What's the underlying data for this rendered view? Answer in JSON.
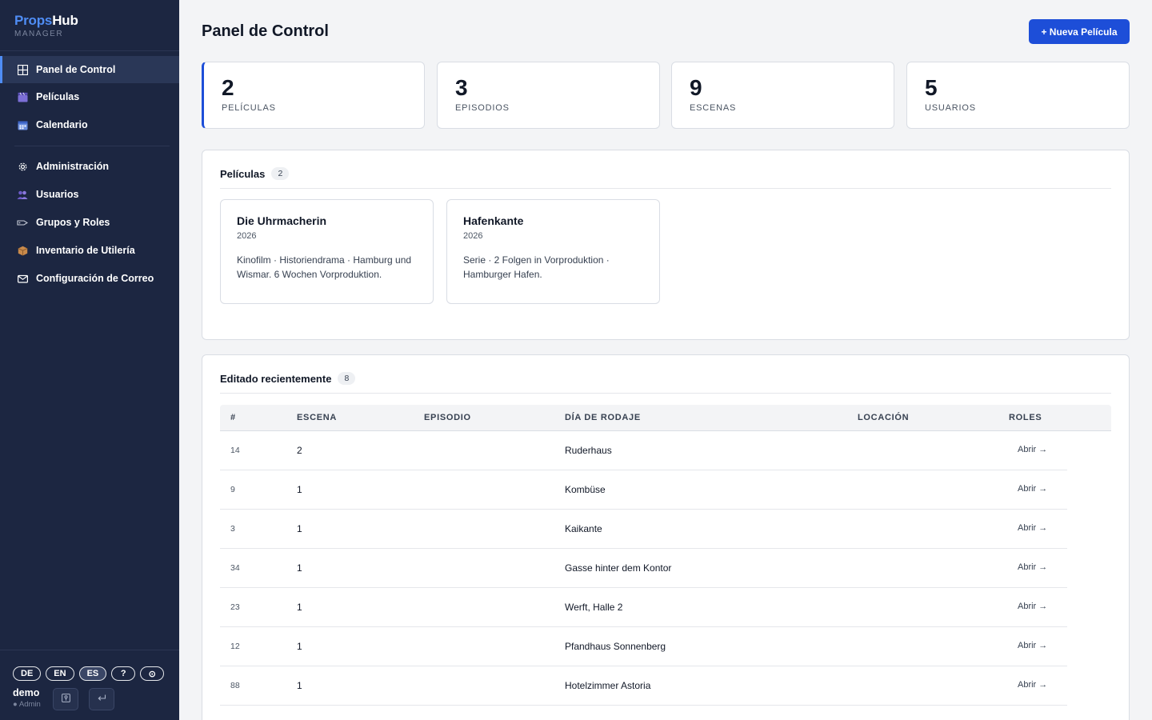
{
  "brand": {
    "name_a": "Props",
    "name_b": "Hub",
    "subtitle": "MANAGER"
  },
  "sidebar": {
    "items": [
      {
        "label": "Panel de Control",
        "icon": "grid-icon"
      },
      {
        "label": "Películas",
        "icon": "clapperboard-icon"
      },
      {
        "label": "Calendario",
        "icon": "calendar-icon"
      },
      {
        "label": "Administración",
        "icon": "gear-icon"
      },
      {
        "label": "Usuarios",
        "icon": "users-icon"
      },
      {
        "label": "Grupos y Roles",
        "icon": "tag-icon"
      },
      {
        "label": "Inventario de Utilería",
        "icon": "box-icon"
      },
      {
        "label": "Configuración de Correo",
        "icon": "mail-icon"
      }
    ],
    "languages": [
      "DE",
      "EN",
      "ES"
    ],
    "selected_language": "ES",
    "help_label": "?",
    "theme_label": "⊙",
    "user": {
      "name": "demo",
      "role": "● Admin"
    }
  },
  "header": {
    "title": "Panel de Control",
    "new_button": "+ Nueva Película"
  },
  "stats": [
    {
      "value": "2",
      "label": "PELÍCULAS"
    },
    {
      "value": "3",
      "label": "EPISODIOS"
    },
    {
      "value": "9",
      "label": "ESCENAS"
    },
    {
      "value": "5",
      "label": "USUARIOS"
    }
  ],
  "films_panel": {
    "title": "Películas",
    "count": "2",
    "films": [
      {
        "title": "Die Uhrmacherin",
        "year": "2026",
        "description": "Kinofilm · Historiendrama · Hamburg und Wismar. 6 Wochen Vorproduktion."
      },
      {
        "title": "Hafenkante",
        "year": "2026",
        "description": "Serie · 2 Folgen in Vorproduktion · Hamburger Hafen."
      }
    ]
  },
  "recent_panel": {
    "title": "Editado recientemente",
    "count": "8",
    "columns": [
      "#",
      "ESCENA",
      "EPISODIO",
      "DÍA DE RODAJE",
      "LOCACIÓN",
      "ROLES"
    ],
    "rows": [
      {
        "num": "14",
        "scene": "2",
        "episode": "",
        "location_name": "Ruderhaus",
        "action": "Abrir →"
      },
      {
        "num": "9",
        "scene": "1",
        "episode": "",
        "location_name": "Kombüse",
        "action": "Abrir →"
      },
      {
        "num": "3",
        "scene": "1",
        "episode": "",
        "location_name": "Kaikante",
        "action": "Abrir →"
      },
      {
        "num": "34",
        "scene": "1",
        "episode": "",
        "location_name": "Gasse hinter dem Kontor",
        "action": "Abrir →"
      },
      {
        "num": "23",
        "scene": "1",
        "episode": "",
        "location_name": "Werft, Halle 2",
        "action": "Abrir →"
      },
      {
        "num": "12",
        "scene": "1",
        "episode": "",
        "location_name": "Pfandhaus Sonnenberg",
        "action": "Abrir →"
      },
      {
        "num": "88",
        "scene": "1",
        "episode": "",
        "location_name": "Hotelzimmer Astoria",
        "action": "Abrir →"
      }
    ]
  },
  "colors": {
    "sidebar_bg": "#1c2641",
    "accent": "#1d4ed8",
    "brand_blue": "#4f8df5"
  }
}
